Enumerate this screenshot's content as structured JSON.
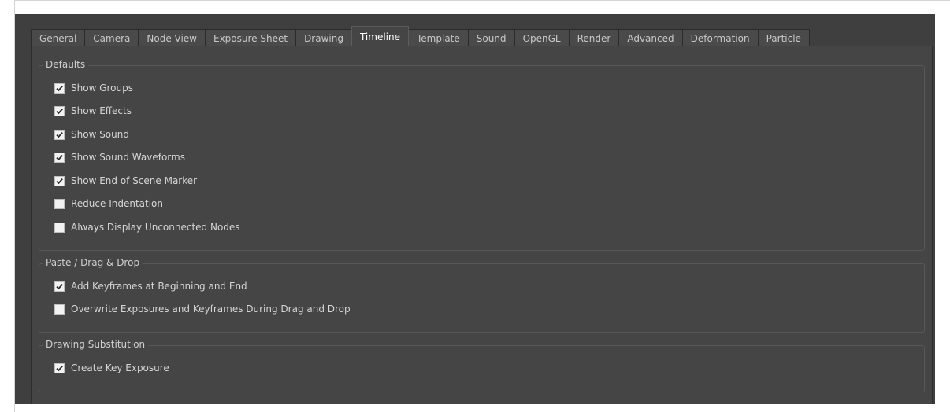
{
  "tabs": [
    {
      "label": "General",
      "active": false
    },
    {
      "label": "Camera",
      "active": false
    },
    {
      "label": "Node View",
      "active": false
    },
    {
      "label": "Exposure Sheet",
      "active": false
    },
    {
      "label": "Drawing",
      "active": false
    },
    {
      "label": "Timeline",
      "active": true
    },
    {
      "label": "Template",
      "active": false
    },
    {
      "label": "Sound",
      "active": false
    },
    {
      "label": "OpenGL",
      "active": false
    },
    {
      "label": "Render",
      "active": false
    },
    {
      "label": "Advanced",
      "active": false
    },
    {
      "label": "Deformation",
      "active": false
    },
    {
      "label": "Particle",
      "active": false
    }
  ],
  "groups": {
    "defaults": {
      "title": "Defaults",
      "options": [
        {
          "label": "Show Groups",
          "checked": true
        },
        {
          "label": "Show Effects",
          "checked": true
        },
        {
          "label": "Show Sound",
          "checked": true
        },
        {
          "label": "Show Sound Waveforms",
          "checked": true
        },
        {
          "label": "Show End of Scene Marker",
          "checked": true
        },
        {
          "label": "Reduce Indentation",
          "checked": false
        },
        {
          "label": "Always Display Unconnected Nodes",
          "checked": false
        }
      ]
    },
    "paste_drag_drop": {
      "title": "Paste / Drag  & Drop",
      "options": [
        {
          "label": "Add Keyframes at Beginning and End",
          "checked": true
        },
        {
          "label": "Overwrite Exposures and Keyframes During Drag and Drop",
          "checked": false
        }
      ]
    },
    "drawing_substitution": {
      "title": "Drawing Substitution",
      "options": [
        {
          "label": "Create Key Exposure",
          "checked": true
        }
      ]
    }
  },
  "colors": {
    "dialog_bg": "#3f3f3f",
    "panel_bg": "#454545",
    "text": "#d6d6d6",
    "checkbox_bg": "#f2f2f2",
    "checkmark": "#2a2a2a"
  }
}
